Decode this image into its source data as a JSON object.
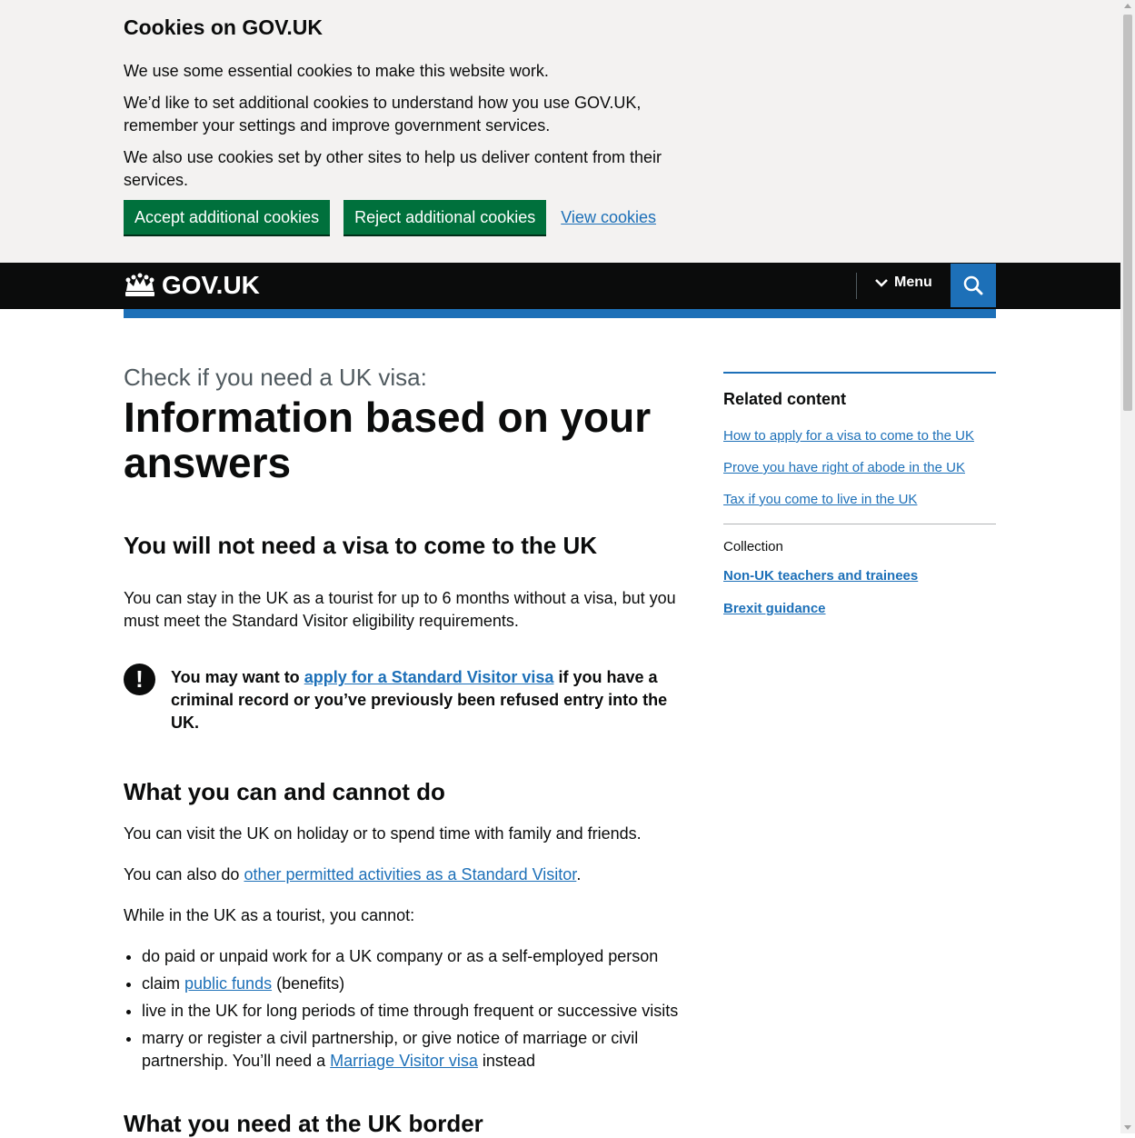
{
  "cookie_banner": {
    "title": "Cookies on GOV.UK",
    "p1": "We use some essential cookies to make this website work.",
    "p2": "We’d like to set additional cookies to understand how you use GOV.UK, remember your settings and improve government services.",
    "p3": "We also use cookies set by other sites to help us deliver content from their services.",
    "accept_label": "Accept additional cookies",
    "reject_label": "Reject additional cookies",
    "view_label": "View cookies"
  },
  "header": {
    "logo_text": "GOV.UK",
    "menu_label": "Menu",
    "search_icon": "search-icon"
  },
  "main": {
    "caption": "Check if you need a UK visa:",
    "title": "Information based on your answers",
    "result_heading": "You will not need a visa to come to the UK",
    "result_text": "You can stay in the UK as a tourist for up to 6 months without a visa, but you must meet the Standard Visitor eligibility requirements.",
    "warning": {
      "icon": "!",
      "pre": "You may want to ",
      "link": "apply for a Standard Visitor visa",
      "post": " if you have a criminal record or you’ve previously been refused entry into the UK."
    },
    "can_heading": "What you can and cannot do",
    "can_p1": "You can visit the UK on holiday or to spend time with family and friends.",
    "can_p2_pre": "You can also do ",
    "can_p2_link": "other permitted activities as a Standard Visitor",
    "can_p2_post": ".",
    "cannot_intro": "While in the UK as a tourist, you cannot:",
    "cannot_list": {
      "item1": "do paid or unpaid work for a UK company or as a self-employed person",
      "item2_pre": "claim ",
      "item2_link": "public funds",
      "item2_post": " (benefits)",
      "item3": "live in the UK for long periods of time through frequent or successive visits",
      "item4_pre": "marry or register a civil partnership, or give notice of marriage or civil partnership. You’ll need a ",
      "item4_link": "Marriage Visitor visa",
      "item4_post": " instead"
    },
    "border_heading": "What you need at the UK border"
  },
  "sidebar": {
    "related_heading": "Related content",
    "related_links": [
      "How to apply for a visa to come to the UK",
      "Prove you have right of abode in the UK",
      "Tax if you come to live in the UK"
    ],
    "collection_label": "Collection",
    "collection_links": [
      "Non-UK teachers and trainees",
      "Brexit guidance"
    ]
  },
  "colors": {
    "green_button": "#00703c",
    "link_blue": "#1d70b8",
    "header_black": "#0b0c0c",
    "banner_grey": "#f3f2f1"
  }
}
